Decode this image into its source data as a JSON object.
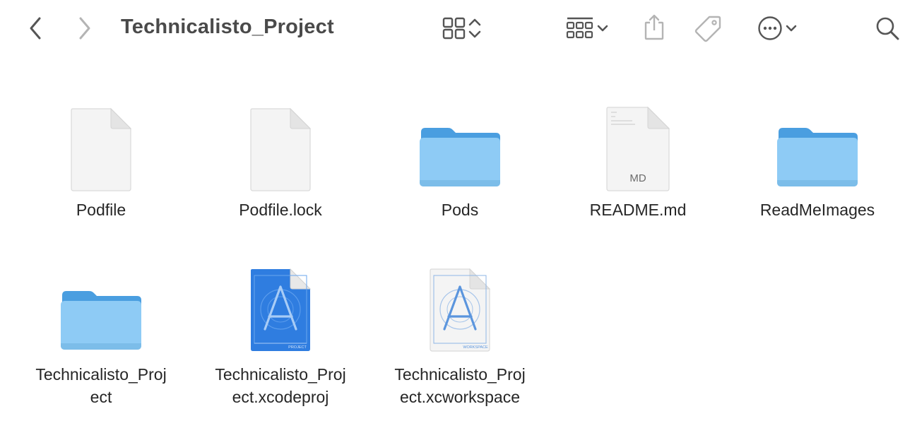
{
  "window": {
    "title": "Technicalisto_Project"
  },
  "toolbar": {
    "back_icon": "chevron-left-icon",
    "forward_icon": "chevron-right-icon",
    "view_icon": "icon-grid-view-icon",
    "group_icon": "group-by-icon",
    "share_icon": "share-icon",
    "tag_icon": "tag-icon",
    "more_icon": "more-actions-icon",
    "search_icon": "search-icon"
  },
  "files": [
    {
      "name": "Podfile",
      "kind": "document"
    },
    {
      "name": "Podfile.lock",
      "kind": "document"
    },
    {
      "name": "Pods",
      "kind": "folder"
    },
    {
      "name": "README.md",
      "kind": "markdown",
      "badge": "MD"
    },
    {
      "name": "ReadMeImages",
      "kind": "folder"
    },
    {
      "name": "Technicalisto_Proj\nect",
      "kind": "folder"
    },
    {
      "name": "Technicalisto_Proj\nect.xcodeproj",
      "kind": "xcodeproj",
      "badge": "PROJECT"
    },
    {
      "name": "Technicalisto_Proj\nect.xcworkspace",
      "kind": "xcworkspace",
      "badge": "WORKSPACE"
    }
  ],
  "colors": {
    "folder_back": "#4a9ee0",
    "folder_front": "#8ecbf5",
    "xcode_blue": "#2f7de0",
    "toolbar_icon": "#555555",
    "toolbar_icon_disabled": "#b4b4b4"
  }
}
